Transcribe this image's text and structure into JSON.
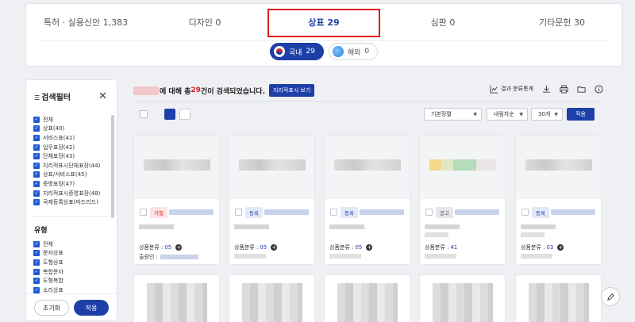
{
  "tabs": [
    {
      "label": "특허 · 실용신안 1,383"
    },
    {
      "label": "디자인 0"
    },
    {
      "label": "상표 29"
    },
    {
      "label": "심판 0"
    },
    {
      "label": "기타문헌 30"
    }
  ],
  "regions": {
    "domestic": {
      "label": "국내",
      "count": "29"
    },
    "overseas": {
      "label": "해외",
      "count": "0"
    }
  },
  "filter": {
    "title": "검색필터",
    "items": [
      "전체",
      "상표(40)",
      "서비스표(41)",
      "업무표장(42)",
      "단체표장(43)",
      "지리적표시단체표장(44)",
      "상표/서비스표(45)",
      "증명표장(47)",
      "지리적표시증명표장(48)",
      "국제등록상표(마드리드)"
    ],
    "type_section": "유형",
    "type_items": [
      "전체",
      "문자상표",
      "도형상표",
      "복합문자",
      "도형복합",
      "소리상표"
    ],
    "reset_label": "초기화",
    "apply_label": "적용"
  },
  "results": {
    "prefix": "에 대해 총 ",
    "count": "29",
    "suffix": "건이 검색되었습니다.",
    "geo_button": "지리적표시 보기",
    "stats_label": "결과 분류통계"
  },
  "controls": {
    "sort": "기본정렬",
    "order": "내림차순",
    "per_page": "30개",
    "apply": "적용"
  },
  "cards": [
    {
      "status": "거절",
      "status_type": "rej",
      "class_label": "상품분류 : ",
      "class_num": "05",
      "applicant_label": "출원인 :"
    },
    {
      "status": "등록",
      "status_type": "reg",
      "class_label": "상품분류 : ",
      "class_num": "05"
    },
    {
      "status": "등록",
      "status_type": "reg",
      "class_label": "상품분류 : ",
      "class_num": "05"
    },
    {
      "status": "공고",
      "status_type": "pub",
      "class_label": "상품분류 : ",
      "class_num": "41"
    },
    {
      "status": "등록",
      "status_type": "reg",
      "class_label": "상품분류 : ",
      "class_num": "03"
    }
  ]
}
